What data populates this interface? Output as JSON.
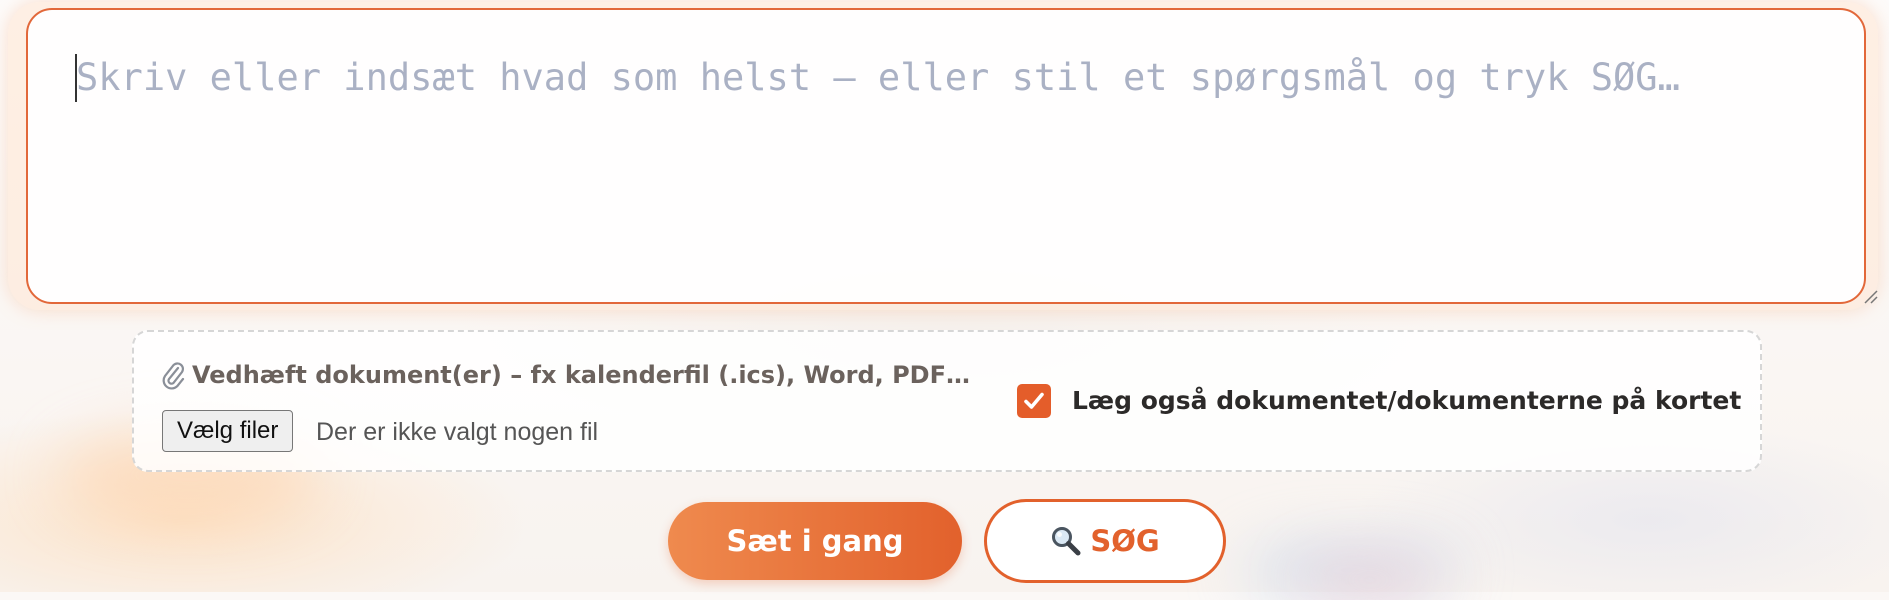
{
  "query": {
    "placeholder": "Skriv eller indsæt hvad som helst – eller stil et spørgsmål og tryk SØG…",
    "value": ""
  },
  "attachments": {
    "label": "Vedhæft dokument(er) – fx kalenderfil (.ics), Word, PDF…",
    "clip_icon": "paperclip-icon",
    "choose_button_label": "Vælg filer",
    "status_text": "Der er ikke valgt nogen fil",
    "checkbox_checked": true,
    "checkbox_label": "Læg også dokumentet/dokumenterne på kortet"
  },
  "actions": {
    "start_label": "Sæt i gang",
    "search_label": "SØG",
    "search_icon": "magnifier-icon"
  },
  "colors": {
    "accent": "#e2612c",
    "accent_light": "#ef8a4e",
    "placeholder": "#aab1c4",
    "label": "#6b625d"
  }
}
